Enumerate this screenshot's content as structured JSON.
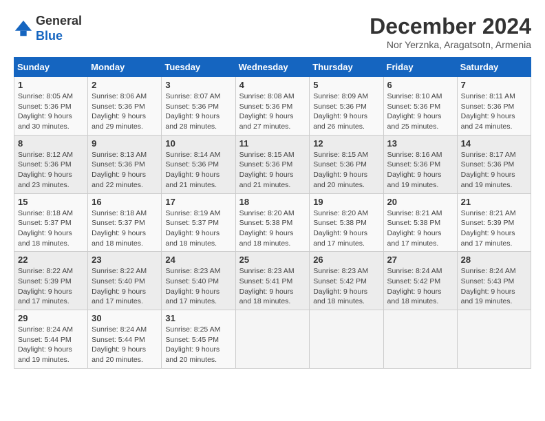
{
  "logo": {
    "general": "General",
    "blue": "Blue"
  },
  "title": "December 2024",
  "subtitle": "Nor Yerznka, Aragatsotn, Armenia",
  "days_header": [
    "Sunday",
    "Monday",
    "Tuesday",
    "Wednesday",
    "Thursday",
    "Friday",
    "Saturday"
  ],
  "weeks": [
    [
      {
        "day": 1,
        "sunrise": "8:05 AM",
        "sunset": "5:36 PM",
        "daylight": "9 hours and 30 minutes."
      },
      {
        "day": 2,
        "sunrise": "8:06 AM",
        "sunset": "5:36 PM",
        "daylight": "9 hours and 29 minutes."
      },
      {
        "day": 3,
        "sunrise": "8:07 AM",
        "sunset": "5:36 PM",
        "daylight": "9 hours and 28 minutes."
      },
      {
        "day": 4,
        "sunrise": "8:08 AM",
        "sunset": "5:36 PM",
        "daylight": "9 hours and 27 minutes."
      },
      {
        "day": 5,
        "sunrise": "8:09 AM",
        "sunset": "5:36 PM",
        "daylight": "9 hours and 26 minutes."
      },
      {
        "day": 6,
        "sunrise": "8:10 AM",
        "sunset": "5:36 PM",
        "daylight": "9 hours and 25 minutes."
      },
      {
        "day": 7,
        "sunrise": "8:11 AM",
        "sunset": "5:36 PM",
        "daylight": "9 hours and 24 minutes."
      }
    ],
    [
      {
        "day": 8,
        "sunrise": "8:12 AM",
        "sunset": "5:36 PM",
        "daylight": "9 hours and 23 minutes."
      },
      {
        "day": 9,
        "sunrise": "8:13 AM",
        "sunset": "5:36 PM",
        "daylight": "9 hours and 22 minutes."
      },
      {
        "day": 10,
        "sunrise": "8:14 AM",
        "sunset": "5:36 PM",
        "daylight": "9 hours and 21 minutes."
      },
      {
        "day": 11,
        "sunrise": "8:15 AM",
        "sunset": "5:36 PM",
        "daylight": "9 hours and 21 minutes."
      },
      {
        "day": 12,
        "sunrise": "8:15 AM",
        "sunset": "5:36 PM",
        "daylight": "9 hours and 20 minutes."
      },
      {
        "day": 13,
        "sunrise": "8:16 AM",
        "sunset": "5:36 PM",
        "daylight": "9 hours and 19 minutes."
      },
      {
        "day": 14,
        "sunrise": "8:17 AM",
        "sunset": "5:36 PM",
        "daylight": "9 hours and 19 minutes."
      }
    ],
    [
      {
        "day": 15,
        "sunrise": "8:18 AM",
        "sunset": "5:37 PM",
        "daylight": "9 hours and 18 minutes."
      },
      {
        "day": 16,
        "sunrise": "8:18 AM",
        "sunset": "5:37 PM",
        "daylight": "9 hours and 18 minutes."
      },
      {
        "day": 17,
        "sunrise": "8:19 AM",
        "sunset": "5:37 PM",
        "daylight": "9 hours and 18 minutes."
      },
      {
        "day": 18,
        "sunrise": "8:20 AM",
        "sunset": "5:38 PM",
        "daylight": "9 hours and 18 minutes."
      },
      {
        "day": 19,
        "sunrise": "8:20 AM",
        "sunset": "5:38 PM",
        "daylight": "9 hours and 17 minutes."
      },
      {
        "day": 20,
        "sunrise": "8:21 AM",
        "sunset": "5:38 PM",
        "daylight": "9 hours and 17 minutes."
      },
      {
        "day": 21,
        "sunrise": "8:21 AM",
        "sunset": "5:39 PM",
        "daylight": "9 hours and 17 minutes."
      }
    ],
    [
      {
        "day": 22,
        "sunrise": "8:22 AM",
        "sunset": "5:39 PM",
        "daylight": "9 hours and 17 minutes."
      },
      {
        "day": 23,
        "sunrise": "8:22 AM",
        "sunset": "5:40 PM",
        "daylight": "9 hours and 17 minutes."
      },
      {
        "day": 24,
        "sunrise": "8:23 AM",
        "sunset": "5:40 PM",
        "daylight": "9 hours and 17 minutes."
      },
      {
        "day": 25,
        "sunrise": "8:23 AM",
        "sunset": "5:41 PM",
        "daylight": "9 hours and 18 minutes."
      },
      {
        "day": 26,
        "sunrise": "8:23 AM",
        "sunset": "5:42 PM",
        "daylight": "9 hours and 18 minutes."
      },
      {
        "day": 27,
        "sunrise": "8:24 AM",
        "sunset": "5:42 PM",
        "daylight": "9 hours and 18 minutes."
      },
      {
        "day": 28,
        "sunrise": "8:24 AM",
        "sunset": "5:43 PM",
        "daylight": "9 hours and 19 minutes."
      }
    ],
    [
      {
        "day": 29,
        "sunrise": "8:24 AM",
        "sunset": "5:44 PM",
        "daylight": "9 hours and 19 minutes."
      },
      {
        "day": 30,
        "sunrise": "8:24 AM",
        "sunset": "5:44 PM",
        "daylight": "9 hours and 20 minutes."
      },
      {
        "day": 31,
        "sunrise": "8:25 AM",
        "sunset": "5:45 PM",
        "daylight": "9 hours and 20 minutes."
      },
      null,
      null,
      null,
      null
    ]
  ],
  "labels": {
    "sunrise": "Sunrise: ",
    "sunset": "Sunset: ",
    "daylight": "Daylight: "
  }
}
